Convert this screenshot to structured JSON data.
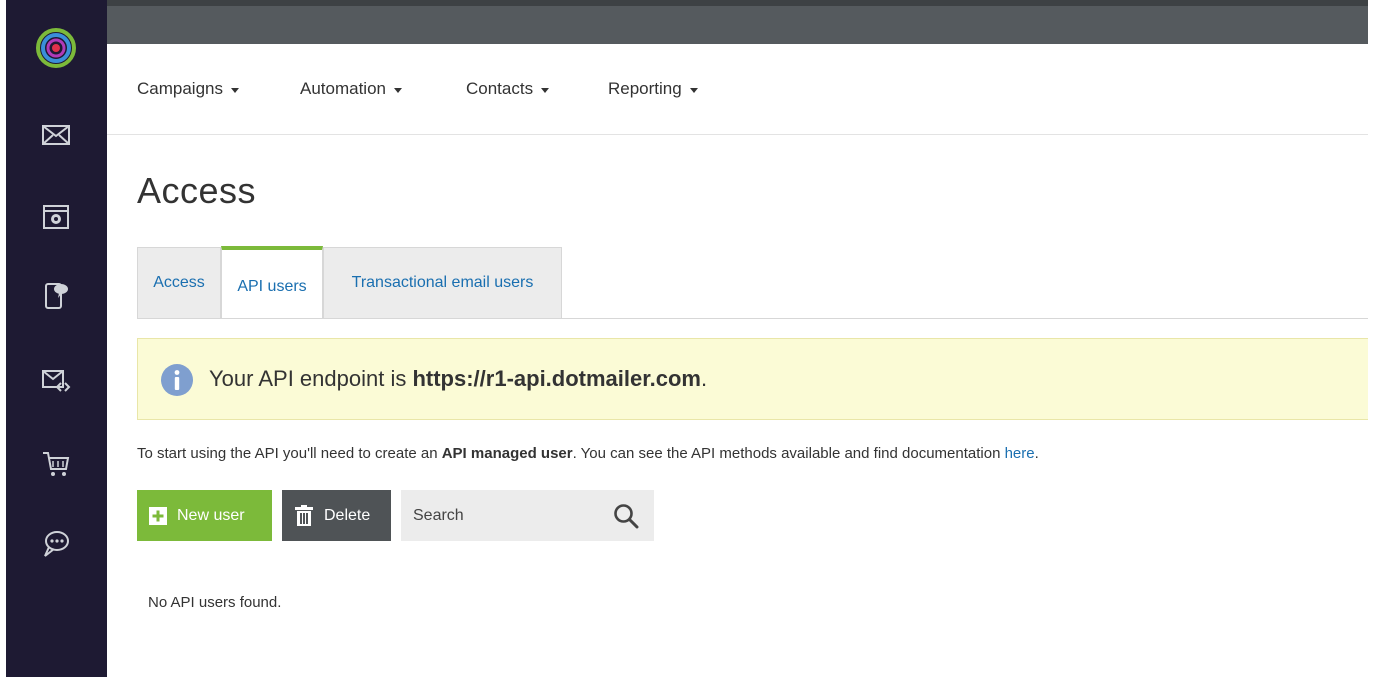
{
  "sidebar": {
    "logo": "dotdigital-logo",
    "items": [
      {
        "icon": "envelope-icon",
        "label": ""
      },
      {
        "icon": "browser-page-icon",
        "label": ""
      },
      {
        "icon": "mobile-message-icon",
        "label": ""
      },
      {
        "icon": "email-code-icon",
        "label": ""
      },
      {
        "icon": "shopping-cart-icon",
        "label": ""
      },
      {
        "icon": "chat-bubble-icon",
        "label": ""
      }
    ]
  },
  "nav": {
    "items": [
      {
        "label": "Campaigns"
      },
      {
        "label": "Automation"
      },
      {
        "label": "Contacts"
      },
      {
        "label": "Reporting"
      }
    ]
  },
  "page": {
    "title": "Access"
  },
  "tabs": [
    {
      "label": "Access",
      "active": false
    },
    {
      "label": "API users",
      "active": true
    },
    {
      "label": "Transactional email users",
      "active": false
    }
  ],
  "alert": {
    "prefix": "Your API endpoint is ",
    "endpoint": "https://r1-api.dotmailer.com",
    "suffix": "."
  },
  "info": {
    "part1": "To start using the API you'll need to create an ",
    "bold": "API managed user",
    "part2": ". You can see the API methods available and find documentation ",
    "link": "here",
    "part3": "."
  },
  "toolbar": {
    "new_label": "New user",
    "delete_label": "Delete",
    "search_placeholder": "Search"
  },
  "results": {
    "empty_message": "No API users found."
  },
  "colors": {
    "sidebar_bg": "#1e1a33",
    "topbar_bg": "#555a5e",
    "accent_green": "#7cba3a",
    "link_blue": "#1a6fb0",
    "alert_bg": "#fbfbd6",
    "delete_bg": "#4f5356"
  }
}
